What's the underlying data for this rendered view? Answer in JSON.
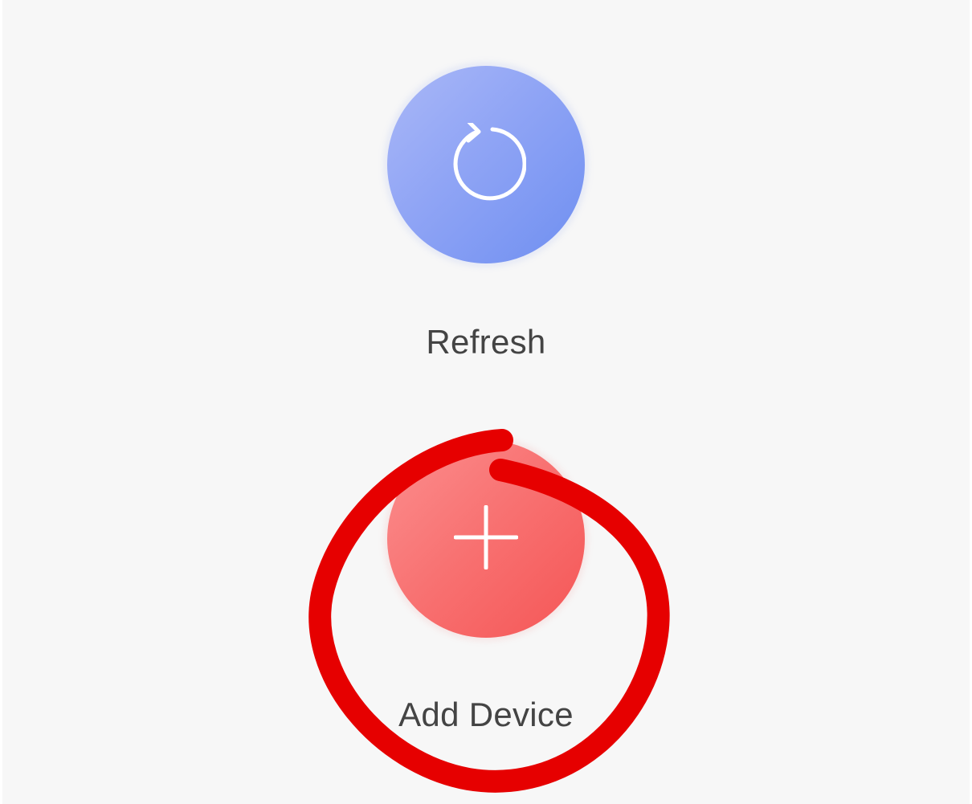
{
  "actions": {
    "refresh": {
      "label": "Refresh",
      "icon": "refresh-icon",
      "color": "#8fa4f5"
    },
    "add_device": {
      "label": "Add Device",
      "icon": "plus-icon",
      "color": "#f87070"
    }
  },
  "annotation": {
    "shape": "hand-drawn circle",
    "color": "#e60000"
  }
}
